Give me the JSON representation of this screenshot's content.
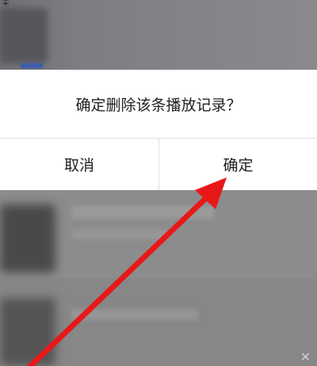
{
  "dialog": {
    "message": "确定删除该条播放记录？",
    "cancel_label": "取消",
    "confirm_label": "确定"
  },
  "corner_glyph": "∓",
  "watermark_glyph": "✕",
  "colors": {
    "annotation_arrow": "#e81818",
    "dialog_background": "#ffffff",
    "overlay": "#878787"
  }
}
